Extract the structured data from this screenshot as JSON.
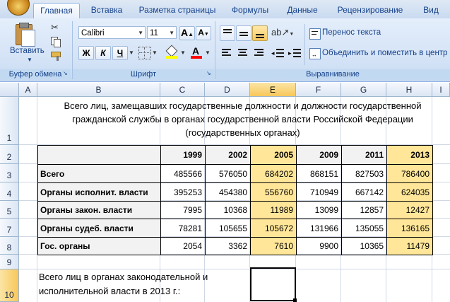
{
  "ribbon": {
    "tabs": [
      "Главная",
      "Вставка",
      "Разметка страницы",
      "Формулы",
      "Данные",
      "Рецензирование",
      "Вид"
    ],
    "active_tab": 0,
    "clipboard": {
      "paste_label": "Вставить",
      "group_label": "Буфер обмена"
    },
    "font": {
      "name": "Calibri",
      "size": "11",
      "bold": "Ж",
      "italic": "К",
      "underline": "Ч",
      "group_label": "Шрифт"
    },
    "alignment": {
      "wrap_text": "Перенос текста",
      "merge_center": "Объединить и поместить в центр",
      "group_label": "Выравнивание"
    }
  },
  "columns": [
    "A",
    "B",
    "C",
    "D",
    "E",
    "F",
    "G",
    "H",
    "I"
  ],
  "selected_column": "E",
  "rows": [
    "1",
    "2",
    "3",
    "4",
    "5",
    "7",
    "8",
    "9",
    "10"
  ],
  "selected_row": "10",
  "sheet": {
    "title": "Всего лиц, замещавших государственные должности и должности государственной гражданской службы в органах государственной власти Российской Федерации (государственных органах)",
    "years": [
      "1999",
      "2002",
      "2005",
      "2009",
      "2011",
      "2013"
    ],
    "table": [
      {
        "label": "Всего",
        "values": [
          "485566",
          "576050",
          "684202",
          "868151",
          "827503",
          "786400"
        ]
      },
      {
        "label": "Органы исполнит. власти",
        "values": [
          "395253",
          "454380",
          "556760",
          "710949",
          "667142",
          "624035"
        ]
      },
      {
        "label": "Органы закон. власти",
        "values": [
          "7995",
          "10368",
          "11989",
          "13099",
          "12857",
          "12427"
        ]
      },
      {
        "label": "Органы судеб. власти",
        "values": [
          "78281",
          "105655",
          "105672",
          "131966",
          "135055",
          "136165"
        ]
      },
      {
        "label": "Гос. органы",
        "values": [
          "2054",
          "3362",
          "7610",
          "9900",
          "10365",
          "11479"
        ]
      }
    ],
    "question": "Всего лиц в органах законодательной  и исполнительной власти в 2013 г.:",
    "answer": ""
  }
}
